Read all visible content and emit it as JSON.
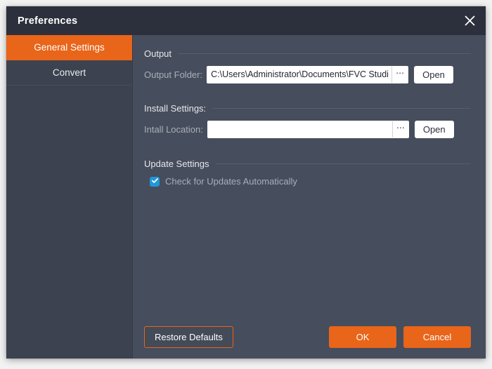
{
  "window": {
    "title": "Preferences",
    "close_icon": "close-icon"
  },
  "sidebar": {
    "items": [
      {
        "label": "General Settings",
        "active": true
      },
      {
        "label": "Convert",
        "active": false
      }
    ]
  },
  "main": {
    "groups": {
      "output": {
        "header": "Output",
        "field_label": "Output Folder:",
        "field_value": "C:\\Users\\Administrator\\Documents\\FVC Studio\\\\",
        "field_placeholder": "",
        "browse_label": "⋯",
        "open_label": "Open"
      },
      "install": {
        "header": "Install Settings:",
        "field_label": "Intall Location:",
        "field_value": "",
        "field_placeholder": "",
        "browse_label": "⋯",
        "open_label": "Open"
      },
      "update": {
        "header": "Update Settings",
        "checkbox_label": "Check for Updates Automatically",
        "checkbox_checked": true
      }
    }
  },
  "footer": {
    "restore_label": "Restore Defaults",
    "ok_label": "OK",
    "cancel_label": "Cancel"
  },
  "colors": {
    "accent_orange": "#e8651a",
    "titlebar_bg": "#2b303c",
    "sidebar_bg": "#3c424f",
    "panel_bg": "#464d5c",
    "checkbox_blue": "#2196d9",
    "label_muted": "#a9aeb8",
    "text_light": "#e6e8ec"
  }
}
